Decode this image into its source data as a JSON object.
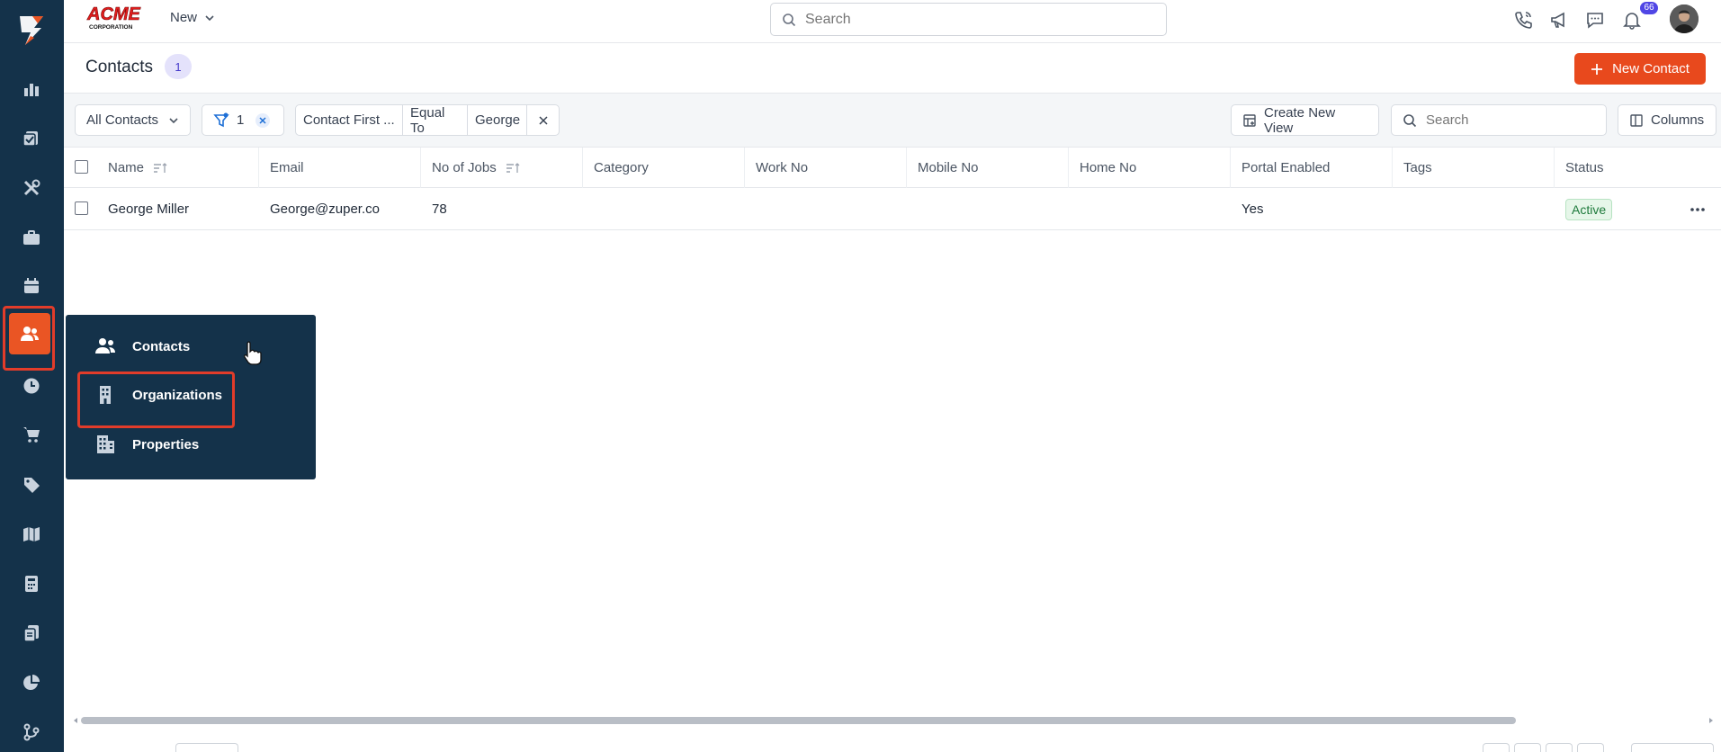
{
  "brand": {
    "logo_text": "ACME CORPORATION"
  },
  "header": {
    "new_label": "New",
    "search_placeholder": "Search",
    "notification_count": "66"
  },
  "page": {
    "title": "Contacts",
    "count": "1",
    "new_contact_label": "New Contact"
  },
  "filters": {
    "view_label": "All Contacts",
    "filter_count": "1",
    "chip": {
      "field": "Contact First ...",
      "operator": "Equal To",
      "value": "George"
    },
    "create_view_label": "Create New View",
    "search_placeholder": "Search",
    "columns_label": "Columns"
  },
  "table": {
    "columns": [
      "Name",
      "Email",
      "No of Jobs",
      "Category",
      "Work No",
      "Mobile No",
      "Home No",
      "Portal Enabled",
      "Tags",
      "Status"
    ],
    "rows": [
      {
        "name": "George Miller",
        "email": "George@zuper.co",
        "jobs": "78",
        "category": "",
        "work_no": "",
        "mobile_no": "",
        "home_no": "",
        "portal_enabled": "Yes",
        "tags": "",
        "status": "Active"
      }
    ]
  },
  "flyout": {
    "items": [
      {
        "label": "Contacts",
        "icon": "users-icon"
      },
      {
        "label": "Organizations",
        "icon": "building-icon"
      },
      {
        "label": "Properties",
        "icon": "apartment-icon"
      }
    ]
  },
  "sidebar": {
    "icons": [
      "dashboard-icon",
      "jobs-icon",
      "tools-icon",
      "briefcase-icon",
      "calendar-icon",
      "contacts-icon",
      "timesheet-icon",
      "cart-icon",
      "tag-icon",
      "map-icon",
      "invoice-icon",
      "documents-icon",
      "reports-icon",
      "workflow-icon"
    ]
  },
  "colors": {
    "sidebar": "#14324a",
    "accent": "#e8491d",
    "highlight": "#e23c2a"
  }
}
